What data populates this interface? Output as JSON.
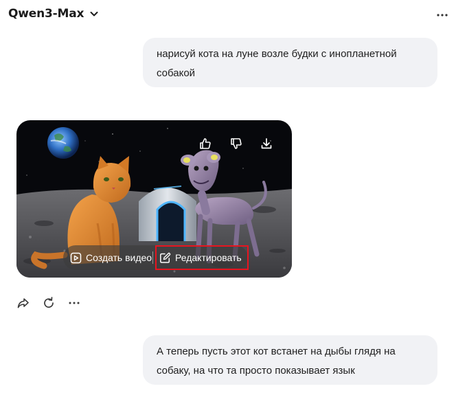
{
  "header": {
    "model_name": "Qwen3-Max",
    "model_dropdown_icon": "chevron-down-icon",
    "menu_icon": "more-horizontal-icon"
  },
  "messages": [
    {
      "role": "user",
      "text": "нарисуй кота на луне возле будки с инопланетной собакой"
    },
    {
      "role": "assistant",
      "image": {
        "description_icons": [
          "thumbs-up-icon",
          "thumbs-down-icon",
          "download-icon"
        ],
        "create_video_label": "Создать видео",
        "edit_label": "Редактировать"
      },
      "actions": [
        "share-icon",
        "regenerate-icon",
        "more-horizontal-icon"
      ]
    },
    {
      "role": "user",
      "text": "А теперь пусть этот кот встанет на дыбы глядя на собаку, на что та просто показывает язык"
    }
  ],
  "colors": {
    "bubble_bg": "#f1f2f5",
    "highlight": "#e8141f",
    "text": "#1e1e1e"
  }
}
